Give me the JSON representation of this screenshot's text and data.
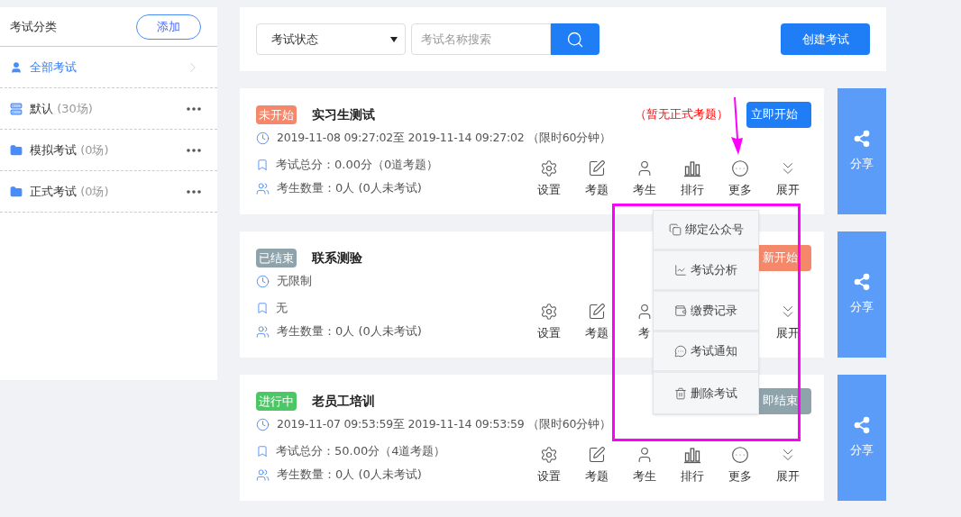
{
  "sidebar": {
    "title": "考试分类",
    "add_button": "添加",
    "items": [
      {
        "kind": "all",
        "label": "全部考试",
        "selected": true
      },
      {
        "kind": "default",
        "label": "默认",
        "count": "(30场)",
        "selected": false
      },
      {
        "kind": "folder",
        "label": "模拟考试",
        "count": "(0场)",
        "selected": false
      },
      {
        "kind": "folder",
        "label": "正式考试",
        "count": "(0场)",
        "selected": false
      }
    ]
  },
  "toolbar": {
    "status_select": "考试状态",
    "search": {
      "placeholder": "考试名称搜索"
    },
    "create_button": "创建考试"
  },
  "exams": [
    {
      "status": {
        "text": "未开始",
        "color": "#f5886a"
      },
      "title": "实习生测试",
      "notice": "（暂无正式考题）",
      "button": {
        "label": "立即开始",
        "kind": "start"
      },
      "time": "2019-11-08 09:27:02至 2019-11-14 09:27:02 （限时60分钟）",
      "score": "考试总分：0.00分（0道考题）",
      "people": "考生数量：0人 (0人未考试)",
      "share": "分享",
      "actions": [
        {
          "kind": "settings",
          "label": "设置"
        },
        {
          "kind": "questions",
          "label": "考题"
        },
        {
          "kind": "students",
          "label": "考生"
        },
        {
          "kind": "ranking",
          "label": "排行"
        },
        {
          "kind": "more",
          "label": "更多"
        },
        {
          "kind": "expand",
          "label": "展开"
        }
      ]
    },
    {
      "status": {
        "text": "已结束",
        "color": "#8fa3ab"
      },
      "title": "联系测验",
      "button": {
        "label": "新开始",
        "kind": "restart"
      },
      "time": "无限制",
      "score": "无",
      "people": "考生数量：0人 (0人未考试)",
      "share": "分享",
      "actions": [
        {
          "kind": "settings",
          "label": "设置"
        },
        {
          "kind": "questions",
          "label": "考题"
        },
        {
          "kind": "students",
          "label": "考"
        },
        {
          "kind": "expand",
          "label": "展开"
        }
      ]
    },
    {
      "status": {
        "text": "进行中",
        "color": "#4cc766"
      },
      "title": "老员工培训",
      "button": {
        "label": "即结束",
        "kind": "end"
      },
      "time": "2019-11-07 09:53:59至 2019-11-14 09:53:59 （限时60分钟）",
      "score": "考试总分：50.00分（4道考题）",
      "people": "考生数量：0人 (0人未考试)",
      "share": "分享",
      "actions": [
        {
          "kind": "settings",
          "label": "设置"
        },
        {
          "kind": "questions",
          "label": "考题"
        },
        {
          "kind": "students",
          "label": "考生"
        },
        {
          "kind": "ranking",
          "label": "排行"
        },
        {
          "kind": "more",
          "label": "更多"
        },
        {
          "kind": "expand",
          "label": "展开"
        }
      ]
    }
  ],
  "more_menu": [
    {
      "kind": "bind",
      "label": "绑定公众号"
    },
    {
      "kind": "analysis",
      "label": "考试分析"
    },
    {
      "kind": "payment",
      "label": "缴费记录"
    },
    {
      "kind": "notify",
      "label": "考试通知"
    },
    {
      "kind": "delete",
      "label": "删除考试"
    }
  ]
}
